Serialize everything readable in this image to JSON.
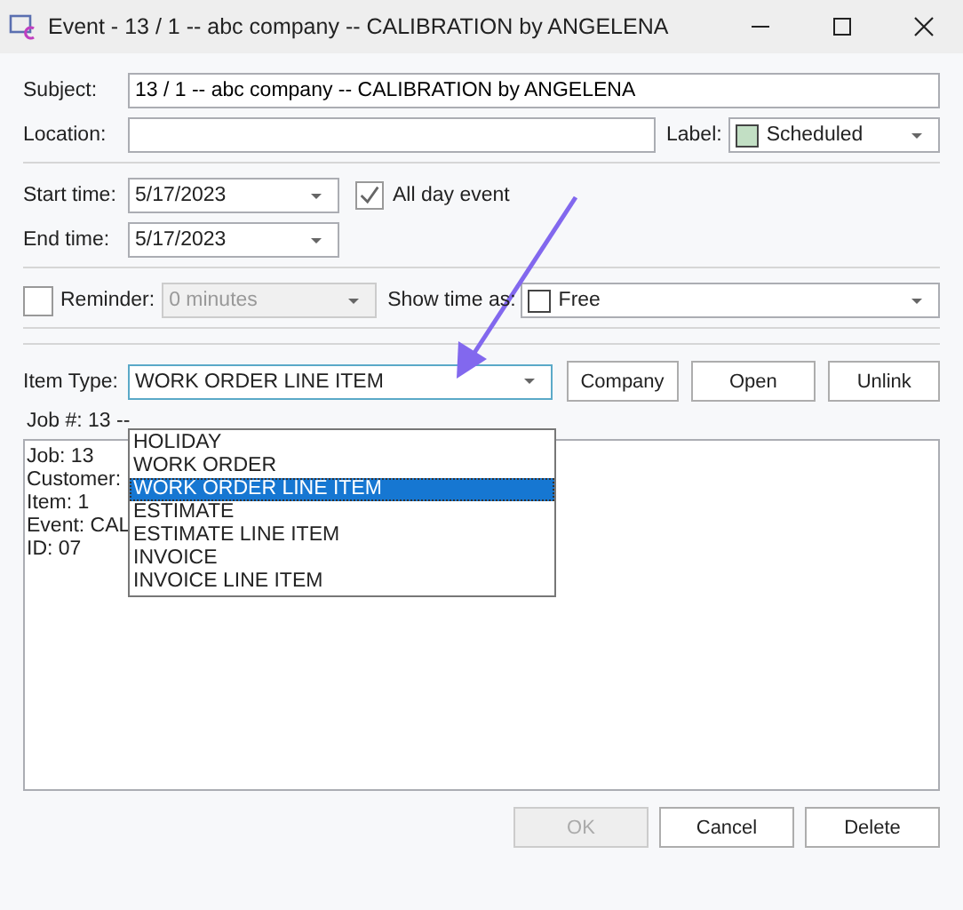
{
  "window": {
    "title": "Event - 13 / 1 -- abc company -- CALIBRATION by ANGELENA"
  },
  "subject": {
    "label": "Subject:",
    "value": "13 / 1 -- abc company -- CALIBRATION by ANGELENA"
  },
  "location": {
    "label": "Location:"
  },
  "event_label": {
    "label": "Label:",
    "value": "Scheduled",
    "color": "#c2dfc4"
  },
  "start_time": {
    "label": "Start time:",
    "value": "5/17/2023"
  },
  "all_day_event": {
    "label": "All day event",
    "checked": true
  },
  "end_time": {
    "label": "End time:",
    "value": "5/17/2023"
  },
  "reminder": {
    "label": "Reminder:",
    "checked": false,
    "value": "0 minutes",
    "disabled": true
  },
  "show_time_as": {
    "label": "Show time as:",
    "value": "Free",
    "color": "#ffffff"
  },
  "item_type": {
    "label": "Item Type:",
    "value": "WORK ORDER LINE ITEM",
    "expanded": true,
    "options": [
      {
        "label": "HOLIDAY",
        "selected": false
      },
      {
        "label": "WORK ORDER",
        "selected": false
      },
      {
        "label": "WORK ORDER LINE ITEM",
        "selected": true
      },
      {
        "label": "ESTIMATE",
        "selected": false
      },
      {
        "label": "ESTIMATE LINE ITEM",
        "selected": false
      },
      {
        "label": "INVOICE",
        "selected": false
      },
      {
        "label": "INVOICE LINE ITEM",
        "selected": false
      }
    ]
  },
  "item_buttons": [
    {
      "label": "Company",
      "disabled": false
    },
    {
      "label": "Open",
      "disabled": false
    },
    {
      "label": "Unlink",
      "disabled": false
    }
  ],
  "job_summary": "Job #: 13 --",
  "notes": [
    "Job:  13",
    "Customer:",
    "Item:  1",
    "Event:  CAL",
    "ID:  07"
  ],
  "footer_buttons": [
    {
      "label": "OK",
      "disabled": true
    },
    {
      "label": "Cancel",
      "disabled": false
    },
    {
      "label": "Delete",
      "disabled": false
    }
  ]
}
